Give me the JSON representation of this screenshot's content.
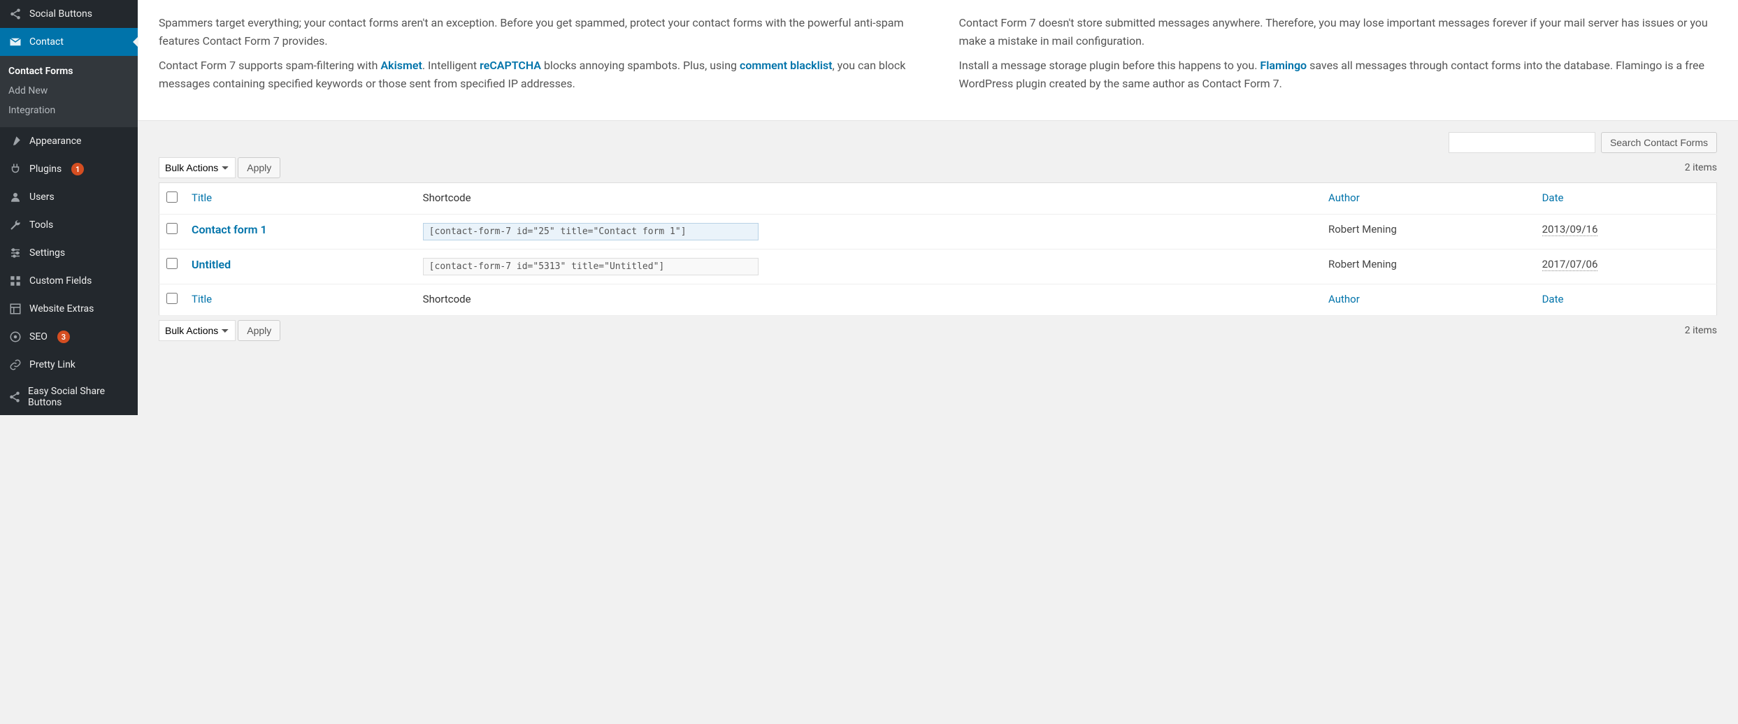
{
  "sidebar": {
    "items": [
      {
        "icon": "share",
        "label": "Social Buttons"
      },
      {
        "icon": "mail",
        "label": "Contact",
        "current": true,
        "submenu": [
          {
            "label": "Contact Forms",
            "selected": true
          },
          {
            "label": "Add New"
          },
          {
            "label": "Integration"
          }
        ]
      },
      {
        "icon": "brush",
        "label": "Appearance"
      },
      {
        "icon": "plug",
        "label": "Plugins",
        "badge": "1"
      },
      {
        "icon": "user",
        "label": "Users"
      },
      {
        "icon": "wrench",
        "label": "Tools"
      },
      {
        "icon": "sliders",
        "label": "Settings"
      },
      {
        "icon": "grid",
        "label": "Custom Fields"
      },
      {
        "icon": "layout",
        "label": "Website Extras"
      },
      {
        "icon": "seo",
        "label": "SEO",
        "badge": "3"
      },
      {
        "icon": "link",
        "label": "Pretty Link"
      },
      {
        "icon": "share",
        "label": "Easy Social Share Buttons"
      }
    ]
  },
  "notices": {
    "left": {
      "p1": "Spammers target everything; your contact forms aren't an exception. Before you get spammed, protect your contact forms with the powerful anti-spam features Contact Form 7 provides.",
      "p2a": "Contact Form 7 supports spam-filtering with ",
      "akismet": "Akismet",
      "p2b": ". Intelligent ",
      "recaptcha": "reCAPTCHA",
      "p2c": " blocks annoying spambots. Plus, using ",
      "blacklist": "comment blacklist",
      "p2d": ", you can block messages containing specified keywords or those sent from specified IP addresses."
    },
    "right": {
      "p1": "Contact Form 7 doesn't store submitted messages anywhere. Therefore, you may lose important messages forever if your mail server has issues or you make a mistake in mail configuration.",
      "p2a": "Install a message storage plugin before this happens to you. ",
      "flamingo": "Flamingo",
      "p2b": " saves all messages through contact forms into the database. Flamingo is a free WordPress plugin created by the same author as Contact Form 7."
    }
  },
  "search": {
    "button": "Search Contact Forms"
  },
  "bulk": {
    "label": "Bulk Actions",
    "apply": "Apply"
  },
  "count_label": "2 items",
  "table": {
    "headers": {
      "title": "Title",
      "shortcode": "Shortcode",
      "author": "Author",
      "date": "Date"
    },
    "rows": [
      {
        "title": "Contact form 1",
        "shortcode": "[contact-form-7 id=\"25\" title=\"Contact form 1\"]",
        "author": "Robert Mening",
        "date": "2013/09/16",
        "selected": true
      },
      {
        "title": "Untitled",
        "shortcode": "[contact-form-7 id=\"5313\" title=\"Untitled\"]",
        "author": "Robert Mening",
        "date": "2017/07/06",
        "selected": false
      }
    ]
  }
}
